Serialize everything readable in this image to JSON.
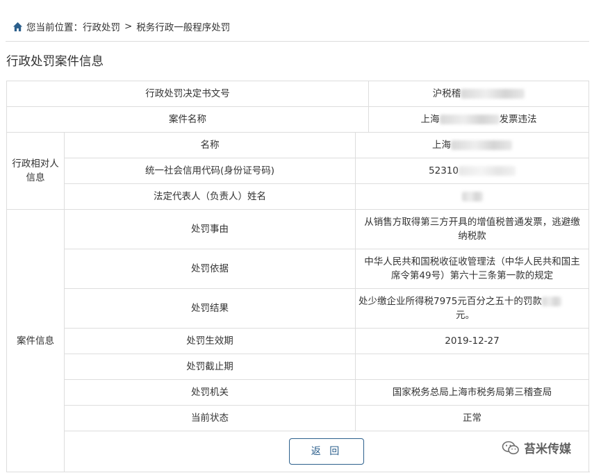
{
  "breadcrumb": {
    "prefix": "您当前位置：",
    "level1": "行政处罚",
    "separator": ">",
    "level2": "税务行政一般程序处罚"
  },
  "page_title": "行政处罚案件信息",
  "rows": {
    "decision_no": {
      "label": "行政处罚决定书文号",
      "value": "沪税稽"
    },
    "case_name": {
      "label": "案件名称",
      "value_prefix": "上海",
      "value_suffix": "发票违法"
    },
    "party_group": "行政相对人信息",
    "party_name": {
      "label": "名称",
      "value": "上海"
    },
    "credit_code": {
      "label": "统一社会信用代码(身份证号码)",
      "value": "52310"
    },
    "legal_rep": {
      "label": "法定代表人（负责人）姓名",
      "value": ""
    },
    "case_group": "案件信息",
    "reason": {
      "label": "处罚事由",
      "value": "从销售方取得第三方开具的增值税普通发票，逃避缴纳税款"
    },
    "basis": {
      "label": "处罚依据",
      "value": "中华人民共和国税收征收管理法（中华人民共和国主席令第49号）第六十三条第一款的规定"
    },
    "result": {
      "label": "处罚结果",
      "value": "处少缴企业所得税7975元百分之五十的罚款",
      "value_end": "元。"
    },
    "effective_date": {
      "label": "处罚生效期",
      "value": "2019-12-27"
    },
    "end_date": {
      "label": "处罚截止期",
      "value": ""
    },
    "authority": {
      "label": "处罚机关",
      "value": "国家税务总局上海市税务局第三稽查局"
    },
    "status": {
      "label": "当前状态",
      "value": "正常"
    }
  },
  "back_button": "返 回",
  "watermark": "苔米传媒",
  "colors": {
    "accent": "#2b5f8c",
    "border": "#dddddd",
    "text": "#333333"
  }
}
